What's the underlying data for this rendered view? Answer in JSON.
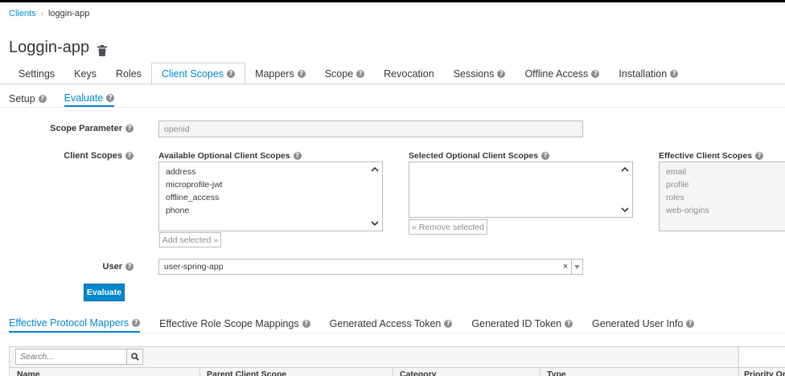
{
  "breadcrumb": {
    "parent": "Clients",
    "separator": "›",
    "current": "loggin-app"
  },
  "page_title": "Loggin-app",
  "tabs": [
    {
      "label": "Settings",
      "help": false,
      "active": false
    },
    {
      "label": "Keys",
      "help": false,
      "active": false
    },
    {
      "label": "Roles",
      "help": false,
      "active": false
    },
    {
      "label": "Client Scopes",
      "help": true,
      "active": true
    },
    {
      "label": "Mappers",
      "help": true,
      "active": false
    },
    {
      "label": "Scope",
      "help": true,
      "active": false
    },
    {
      "label": "Revocation",
      "help": false,
      "active": false
    },
    {
      "label": "Sessions",
      "help": true,
      "active": false
    },
    {
      "label": "Offline Access",
      "help": true,
      "active": false
    },
    {
      "label": "Installation",
      "help": true,
      "active": false
    }
  ],
  "subtabs": [
    {
      "label": "Setup",
      "active": false
    },
    {
      "label": "Evaluate",
      "active": true
    }
  ],
  "form": {
    "scope_parameter": {
      "label": "Scope Parameter",
      "value": "openid"
    },
    "client_scopes_label": "Client Scopes",
    "available": {
      "header": "Available Optional Client Scopes",
      "items": [
        "address",
        "microprofile-jwt",
        "offline_access",
        "phone"
      ],
      "button": "Add selected »"
    },
    "selected": {
      "header": "Selected Optional Client Scopes",
      "items": [],
      "button": "« Remove selected"
    },
    "effective": {
      "header": "Effective Client Scopes",
      "items": [
        "email",
        "profile",
        "roles",
        "web-origins"
      ]
    },
    "user": {
      "label": "User",
      "value": "user-spring-app",
      "clear": "×"
    },
    "evaluate_button": "Evaluate"
  },
  "result_tabs": [
    {
      "label": "Effective Protocol Mappers",
      "active": true
    },
    {
      "label": "Effective Role Scope Mappings",
      "active": false
    },
    {
      "label": "Generated Access Token",
      "active": false
    },
    {
      "label": "Generated ID Token",
      "active": false
    },
    {
      "label": "Generated User Info",
      "active": false
    }
  ],
  "table": {
    "search_placeholder": "Search...",
    "columns": [
      "Name",
      "Parent Client Scope",
      "Category",
      "Type",
      "Priority Or"
    ]
  },
  "colors": {
    "accent": "#0088ce",
    "border": "#bbbbbb",
    "muted": "#8b8d8f"
  }
}
